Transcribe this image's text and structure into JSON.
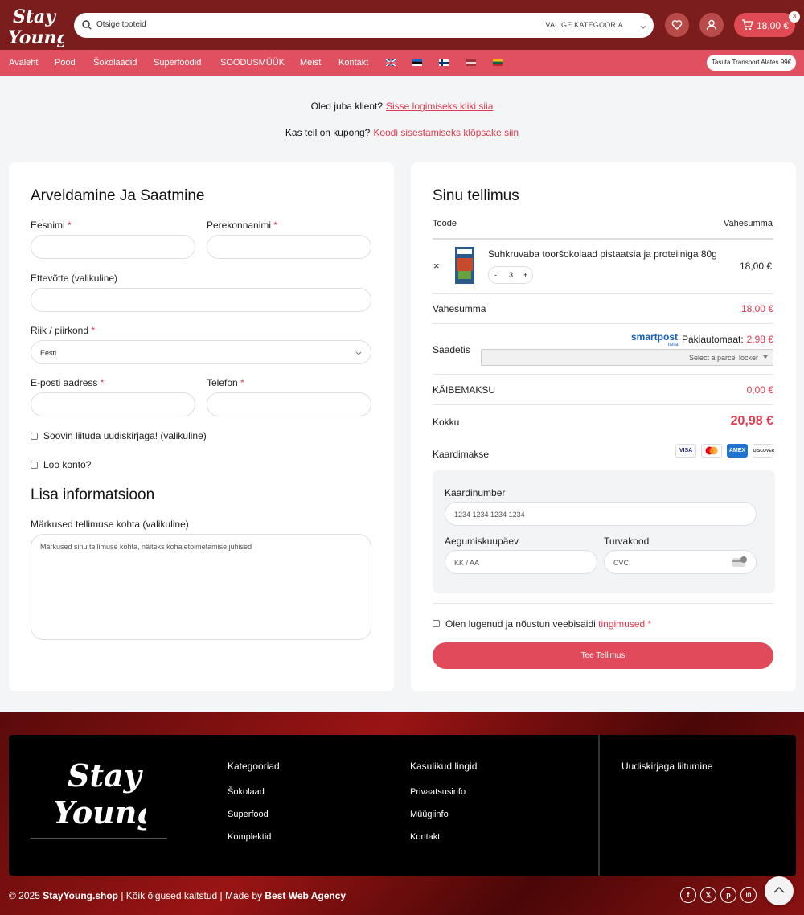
{
  "header": {
    "logo_text": "Stay Young",
    "search_placeholder": "Otsige tooteid",
    "category_select": "VALIGE KATEGOORIA",
    "cart_amount": "18,00 €",
    "cart_count": "3",
    "brand_color": "#7c1d1d",
    "accent_color": "#e04a55"
  },
  "nav": {
    "items": [
      "Avaleht",
      "Pood",
      "Šokolaadid",
      "Superfoodid",
      "SOODUSMÜÜK",
      "Meist",
      "Kontakt"
    ],
    "flags": [
      "uk-flag-icon",
      "estonia-flag-icon",
      "finland-flag-icon",
      "latvia-flag-icon",
      "lithuania-flag-icon"
    ],
    "shipping_badge": "Tasuta Transport Alates 99€"
  },
  "notices": {
    "login_q": "Oled juba klient?",
    "login_link": "Sisse logimiseks kliki siia",
    "coupon_q": "Kas teil on kupong?",
    "coupon_link": "Koodi sisestamiseks klõpsake siin"
  },
  "billing": {
    "title": "Arveldamine Ja Saatmine",
    "first_name": "Eesnimi",
    "last_name": "Perekonnanimi",
    "company": "Ettevõtte (valikuline)",
    "country_label": "Riik / piirkond",
    "country_value": "Eesti",
    "email": "E-posti aadress",
    "phone": "Telefon",
    "newsletter": "Soovin liituda uudiskirjaga! (valikuline)",
    "create_account": "Loo konto?",
    "extra_title": "Lisa informatsioon",
    "notes_label": "Märkused tellimuse kohta (valikuline)",
    "notes_placeholder": "Märkused sinu tellimuse kohta, näiteks kohaletoimetamise juhised",
    "required_mark": "*"
  },
  "order": {
    "title": "Sinu tellimus",
    "col_product": "Toode",
    "col_subtotal": "Vahesumma",
    "remove": "×",
    "product_name": "Suhkruvaba tooršokolaad pistaatsia ja proteiiniga 80g",
    "qty_minus": "-",
    "qty": "3",
    "qty_plus": "+",
    "product_price": "18,00 €",
    "subtotal_label": "Vahesumma",
    "subtotal": "18,00 €",
    "shipping_label": "Saadetis",
    "shipping_brand": "smartpost",
    "shipping_brand_sub": "itella",
    "shipping_method": "Pakiautomaat:",
    "shipping_price": "2,98 €",
    "parcel_select": "Select a parcel locker",
    "vat_label": "KÄIBEMAKSU",
    "vat": "0,00 €",
    "total_label": "Kokku",
    "total": "20,98 €",
    "payment_label": "Kaardimakse",
    "card_icons": [
      "VISA",
      "MC",
      "AMEX",
      "DISCOVER"
    ],
    "card_number_label": "Kaardinumber",
    "card_number_ph": "1234 1234 1234 1234",
    "expiry_label": "Aegumiskuupäev",
    "expiry_ph": "KK / AA",
    "cvc_label": "Turvakood",
    "cvc_ph": "CVC",
    "terms_text": "Olen lugenud ja nõustun veebisaidi",
    "terms_link": "tingimused",
    "terms_req": "*",
    "submit": "Tee Tellimus"
  },
  "footer": {
    "logo_text": "Stay Young",
    "col1_title": "Kategooriad",
    "col1": [
      "Šokolaad",
      "Superfood",
      "Komplektid"
    ],
    "col2_title": "Kasulikud lingid",
    "col2": [
      "Privaatsusinfo",
      "Müügiinfo",
      "Kontakt"
    ],
    "col3_title": "Uudiskirjaga liitumine",
    "copy_prefix": "© 2025",
    "copy_site": "StayYoung.shop",
    "copy_mid": "| Kõik õigused kaitstud | Made by",
    "copy_agency": "Best Web Agency",
    "social": [
      "f",
      "𝕏",
      "p",
      "in"
    ]
  }
}
